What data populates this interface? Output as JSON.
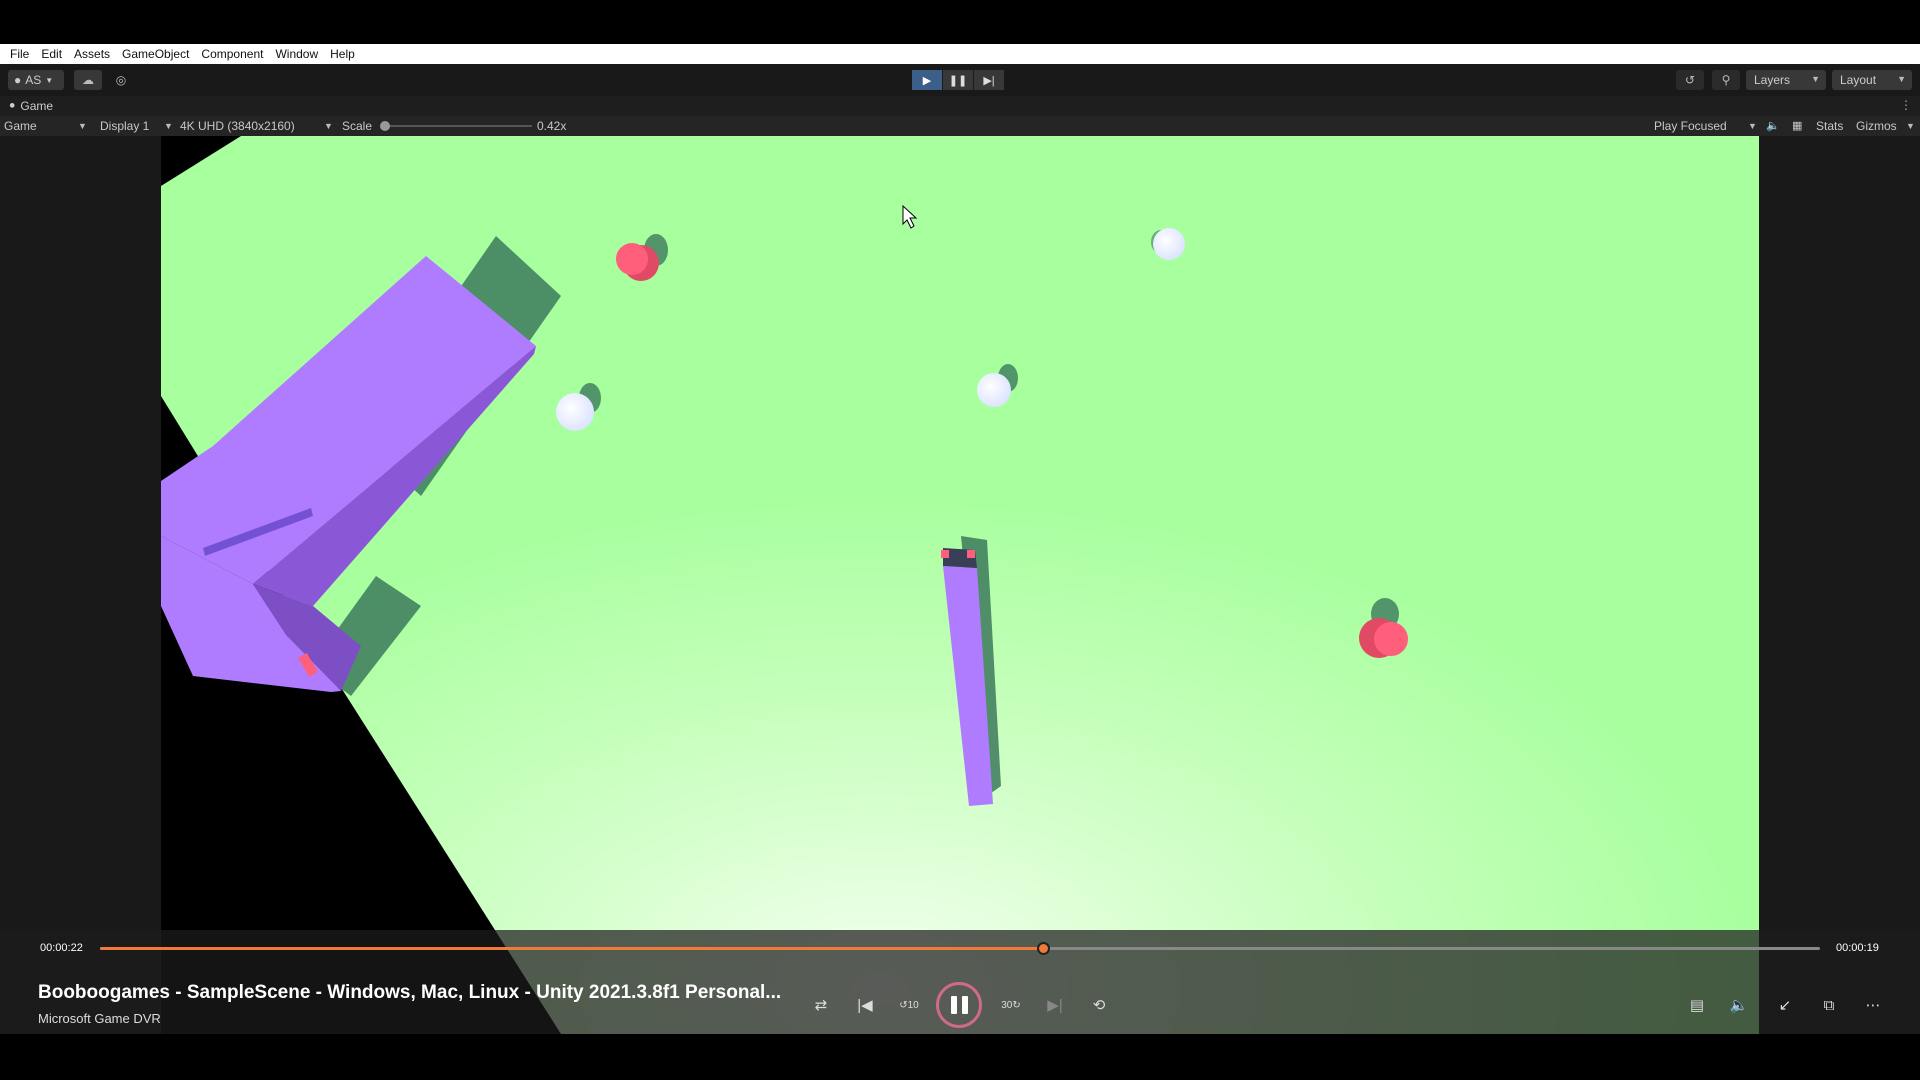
{
  "menu": [
    "File",
    "Edit",
    "Assets",
    "GameObject",
    "Component",
    "Window",
    "Help"
  ],
  "toolbar": {
    "account_label": "AS",
    "layers_label": "Layers",
    "layout_label": "Layout"
  },
  "tab": {
    "label": "Game"
  },
  "game_controls": {
    "mode": "Game",
    "display": "Display 1",
    "resolution": "4K UHD (3840x2160)",
    "scale_label": "Scale",
    "scale_value": "0.42x",
    "play_focused": "Play Focused",
    "stats": "Stats",
    "gizmos": "Gizmos"
  },
  "player": {
    "time_elapsed": "00:00:22",
    "time_remaining": "00:00:19",
    "progress": 0.548,
    "title": "Booboogames - SampleScene - Windows, Mac, Linux - Unity 2021.3.8f1 Personal...",
    "subtitle": "Microsoft Game DVR",
    "skip_back_seconds": "10",
    "skip_forward_seconds": "30"
  },
  "colors": {
    "ground": "#a8ff9e",
    "purple": "#b07cff",
    "red": "#ff5f7a",
    "accent": "#f07a3a",
    "play_active": "#3c5f8a"
  }
}
